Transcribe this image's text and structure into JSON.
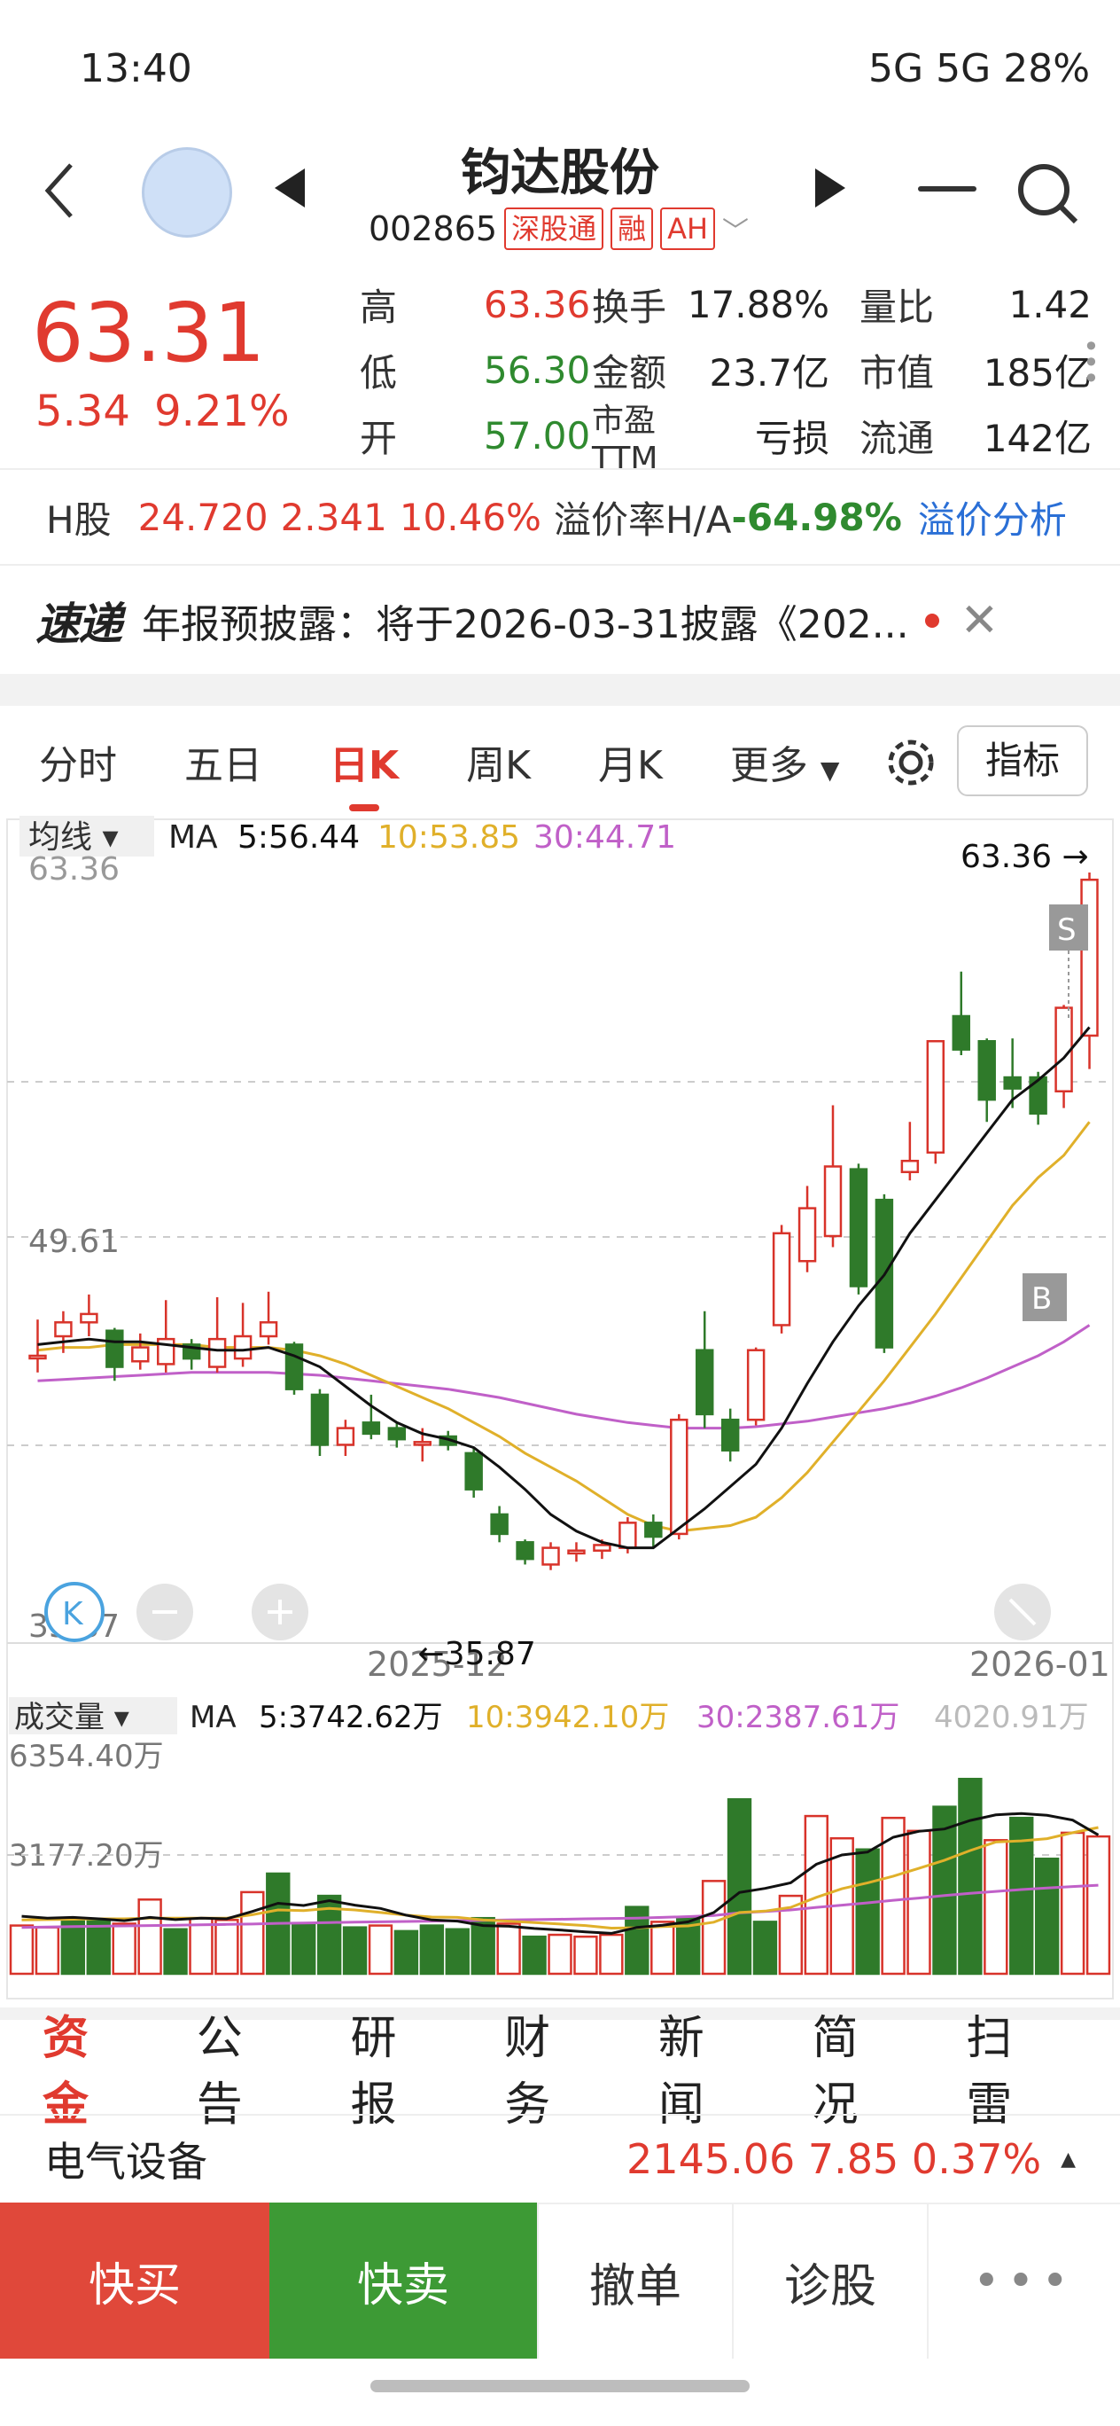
{
  "status": {
    "time": "13:40",
    "right": "5G 5G 28%"
  },
  "header": {
    "title": "钧达股份",
    "code": "002865",
    "tags": [
      "深股通",
      "融",
      "AH"
    ]
  },
  "quote": {
    "price": "63.31",
    "change": "5.34",
    "pct": "9.21%",
    "rows": [
      {
        "l1": "高",
        "v1": "63.36",
        "l2": "换手",
        "v2": "17.88%",
        "l3": "量比",
        "v3": "1.42"
      },
      {
        "l1": "低",
        "v1": "56.30",
        "l2": "金额",
        "v2": "23.7亿",
        "l3": "市值",
        "v3": "185亿"
      },
      {
        "l1": "开",
        "v1": "57.00",
        "l2": "市盈TTM",
        "v2": "亏损",
        "l3": "流通",
        "v3": "142亿"
      }
    ]
  },
  "hshare": {
    "label": "H股",
    "price": "24.720",
    "chg": "2.341",
    "pct": "10.46%",
    "premium_label": "溢价率H/A",
    "premium": "-64.98%",
    "link": "溢价分析"
  },
  "ticker": {
    "logo": "速递",
    "text": "年报预披露：将于2026-03-31披露《202..."
  },
  "tabs": [
    "分时",
    "五日",
    "日K",
    "周K",
    "月K",
    "更多"
  ],
  "indicator_label": "指标",
  "ma_legend": {
    "prefix": "均线",
    "ma": "MA",
    "ma5": "5:56.44",
    "ma10": "10:53.85",
    "ma30": "30:44.71"
  },
  "vol_legend": {
    "prefix": "成交量",
    "ma": "MA",
    "ma5": "5:3742.62万",
    "ma10": "10:3942.10万",
    "ma30": "30:2387.61万",
    "right": "4020.91万"
  },
  "axis": {
    "top": "63.36",
    "mid": "49.61",
    "bottom": "35.87",
    "date1": "2025-12",
    "date2": "2026-01",
    "vol_top": "6354.40万",
    "vol_mid": "3177.20万"
  },
  "annotations": {
    "high": "63.36",
    "low": "35.87",
    "s": "S",
    "b": "B"
  },
  "colors": {
    "up": "#d8332a",
    "down": "#2f7a2a",
    "ma5": "#111111",
    "ma10": "#e0b02a",
    "ma30": "#c060c8"
  },
  "chart_data": {
    "type": "candlestick",
    "title": "",
    "ylim": [
      35.87,
      63.36
    ],
    "candles": [
      {
        "o": 46.0,
        "c": 46.0,
        "h": 47.3,
        "l": 45.4
      },
      {
        "o": 46.7,
        "c": 47.2,
        "h": 47.6,
        "l": 46.1
      },
      {
        "o": 47.2,
        "c": 47.5,
        "h": 48.2,
        "l": 46.7
      },
      {
        "o": 46.9,
        "c": 45.6,
        "h": 47.0,
        "l": 45.1
      },
      {
        "o": 45.8,
        "c": 46.3,
        "h": 46.8,
        "l": 45.5
      },
      {
        "o": 45.7,
        "c": 46.6,
        "h": 48.0,
        "l": 45.4
      },
      {
        "o": 46.4,
        "c": 45.9,
        "h": 46.6,
        "l": 45.5
      },
      {
        "o": 45.6,
        "c": 46.6,
        "h": 48.1,
        "l": 45.4
      },
      {
        "o": 45.9,
        "c": 46.7,
        "h": 47.9,
        "l": 45.6
      },
      {
        "o": 46.7,
        "c": 47.2,
        "h": 48.3,
        "l": 46.4
      },
      {
        "o": 46.4,
        "c": 44.8,
        "h": 46.5,
        "l": 44.6
      },
      {
        "o": 44.6,
        "c": 42.8,
        "h": 44.8,
        "l": 42.4
      },
      {
        "o": 42.8,
        "c": 43.4,
        "h": 43.7,
        "l": 42.4
      },
      {
        "o": 43.6,
        "c": 43.2,
        "h": 44.6,
        "l": 43.0
      },
      {
        "o": 43.4,
        "c": 43.0,
        "h": 43.6,
        "l": 42.7
      },
      {
        "o": 42.8,
        "c": 42.9,
        "h": 43.4,
        "l": 42.2
      },
      {
        "o": 43.1,
        "c": 42.8,
        "h": 43.3,
        "l": 42.6
      },
      {
        "o": 42.5,
        "c": 41.2,
        "h": 42.7,
        "l": 40.9
      },
      {
        "o": 40.3,
        "c": 39.6,
        "h": 40.6,
        "l": 39.3
      },
      {
        "o": 39.3,
        "c": 38.7,
        "h": 39.4,
        "l": 38.5
      },
      {
        "o": 38.5,
        "c": 39.1,
        "h": 39.3,
        "l": 38.3
      },
      {
        "o": 38.9,
        "c": 39.0,
        "h": 39.3,
        "l": 38.6
      },
      {
        "o": 39.0,
        "c": 39.2,
        "h": 39.4,
        "l": 38.7
      },
      {
        "o": 39.1,
        "c": 40.0,
        "h": 40.2,
        "l": 38.9
      },
      {
        "o": 40.0,
        "c": 39.5,
        "h": 40.3,
        "l": 39.1
      },
      {
        "o": 39.6,
        "c": 43.7,
        "h": 43.9,
        "l": 39.4
      },
      {
        "o": 46.2,
        "c": 43.9,
        "h": 47.6,
        "l": 43.4
      },
      {
        "o": 43.7,
        "c": 42.6,
        "h": 44.1,
        "l": 42.2
      },
      {
        "o": 43.7,
        "c": 46.2,
        "h": 46.3,
        "l": 43.5
      },
      {
        "o": 47.1,
        "c": 50.4,
        "h": 50.7,
        "l": 46.8
      },
      {
        "o": 49.4,
        "c": 51.3,
        "h": 52.1,
        "l": 49.0
      },
      {
        "o": 50.3,
        "c": 52.8,
        "h": 55.0,
        "l": 49.9
      },
      {
        "o": 52.7,
        "c": 48.5,
        "h": 52.9,
        "l": 48.2
      },
      {
        "o": 51.6,
        "c": 46.3,
        "h": 51.8,
        "l": 46.1
      },
      {
        "o": 52.6,
        "c": 53.0,
        "h": 54.4,
        "l": 52.3
      },
      {
        "o": 53.3,
        "c": 57.3,
        "h": 57.3,
        "l": 52.9
      },
      {
        "o": 58.2,
        "c": 57.0,
        "h": 59.8,
        "l": 56.8
      },
      {
        "o": 57.3,
        "c": 55.2,
        "h": 57.4,
        "l": 54.4
      },
      {
        "o": 56.0,
        "c": 55.6,
        "h": 57.4,
        "l": 54.9
      },
      {
        "o": 56.0,
        "c": 54.7,
        "h": 56.2,
        "l": 54.3
      },
      {
        "o": 55.5,
        "c": 58.5,
        "h": 58.6,
        "l": 54.9
      },
      {
        "o": 57.5,
        "c": 63.1,
        "h": 63.36,
        "l": 56.3
      }
    ],
    "ma5": [
      46.4,
      46.5,
      46.6,
      46.5,
      46.5,
      46.4,
      46.3,
      46.2,
      46.2,
      46.3,
      46.0,
      45.6,
      44.9,
      44.2,
      43.6,
      43.2,
      43.0,
      42.7,
      42.0,
      41.2,
      40.3,
      39.7,
      39.3,
      39.1,
      39.1,
      39.8,
      40.5,
      41.3,
      42.1,
      43.4,
      45.0,
      46.5,
      47.8,
      48.9,
      50.4,
      51.6,
      52.8,
      54.0,
      55.2,
      55.9,
      56.7,
      57.8
    ],
    "ma10": [
      46.2,
      46.3,
      46.3,
      46.4,
      46.4,
      46.4,
      46.4,
      46.3,
      46.3,
      46.3,
      46.2,
      46.0,
      45.7,
      45.3,
      44.9,
      44.5,
      44.1,
      43.6,
      43.1,
      42.5,
      42.0,
      41.5,
      40.9,
      40.3,
      39.9,
      39.7,
      39.8,
      39.9,
      40.2,
      40.9,
      41.8,
      42.9,
      44.0,
      45.1,
      46.3,
      47.5,
      48.8,
      50.1,
      51.4,
      52.4,
      53.2,
      54.4
    ],
    "ma30": [
      45.1,
      45.15,
      45.2,
      45.25,
      45.3,
      45.35,
      45.4,
      45.4,
      45.4,
      45.4,
      45.35,
      45.3,
      45.2,
      45.1,
      45.0,
      44.9,
      44.8,
      44.65,
      44.5,
      44.3,
      44.1,
      43.9,
      43.75,
      43.6,
      43.5,
      43.4,
      43.4,
      43.4,
      43.45,
      43.55,
      43.65,
      43.8,
      43.95,
      44.1,
      44.3,
      44.55,
      44.85,
      45.2,
      45.6,
      46.0,
      46.5,
      47.1
    ],
    "volume_ylim": [
      0,
      6354.4
    ],
    "volume": [
      1300,
      1250,
      1500,
      1450,
      1350,
      2000,
      1200,
      1500,
      1450,
      2200,
      2700,
      1350,
      2100,
      1250,
      1300,
      1150,
      1300,
      1200,
      1500,
      1350,
      1000,
      1050,
      1000,
      1050,
      1800,
      1400,
      1500,
      2500,
      4700,
      1400,
      2100,
      4250,
      3650,
      3350,
      4200,
      3850,
      4500,
      5250,
      3600,
      4200,
      3100,
      3800,
      3700
    ],
    "volume_up": [
      true,
      true,
      false,
      false,
      true,
      true,
      false,
      true,
      true,
      true,
      false,
      false,
      false,
      false,
      true,
      false,
      false,
      false,
      false,
      true,
      false,
      true,
      true,
      true,
      false,
      true,
      false,
      true,
      false,
      false,
      true,
      true,
      true,
      false,
      true,
      true,
      false,
      false,
      true,
      false,
      false,
      true,
      true
    ],
    "vol_ma5": [
      1550,
      1500,
      1520,
      1480,
      1430,
      1520,
      1460,
      1500,
      1480,
      1680,
      1900,
      1840,
      1970,
      1850,
      1760,
      1580,
      1450,
      1420,
      1300,
      1280,
      1220,
      1180,
      1130,
      1090,
      1250,
      1310,
      1400,
      1650,
      2190,
      2300,
      2450,
      2950,
      3200,
      3280,
      3680,
      3840,
      3900,
      4130,
      4280,
      4320,
      4270,
      4140,
      3742
    ],
    "vol_ma10": [
      1450,
      1460,
      1470,
      1480,
      1480,
      1500,
      1500,
      1500,
      1500,
      1590,
      1720,
      1700,
      1760,
      1720,
      1650,
      1580,
      1530,
      1520,
      1450,
      1420,
      1380,
      1340,
      1300,
      1230,
      1240,
      1270,
      1290,
      1390,
      1650,
      1690,
      1790,
      2060,
      2290,
      2450,
      2630,
      2840,
      3060,
      3320,
      3550,
      3580,
      3640,
      3800,
      3942
    ],
    "vol_ma30": [
      1250,
      1260,
      1270,
      1280,
      1290,
      1300,
      1310,
      1320,
      1330,
      1340,
      1360,
      1370,
      1380,
      1390,
      1400,
      1410,
      1420,
      1430,
      1440,
      1450,
      1460,
      1470,
      1480,
      1490,
      1500,
      1520,
      1540,
      1570,
      1640,
      1680,
      1720,
      1790,
      1850,
      1910,
      1980,
      2040,
      2110,
      2170,
      2220,
      2270,
      2310,
      2350,
      2387
    ]
  },
  "bottom_tabs": [
    "资金",
    "公告",
    "研报",
    "财务",
    "新闻",
    "简况",
    "扫雷"
  ],
  "sector": {
    "name": "电气设备",
    "values": "2145.06  7.85  0.37%"
  },
  "actions": {
    "buy": "快买",
    "sell": "快卖",
    "cancel": "撤单",
    "diagnose": "诊股",
    "more": "•••"
  }
}
